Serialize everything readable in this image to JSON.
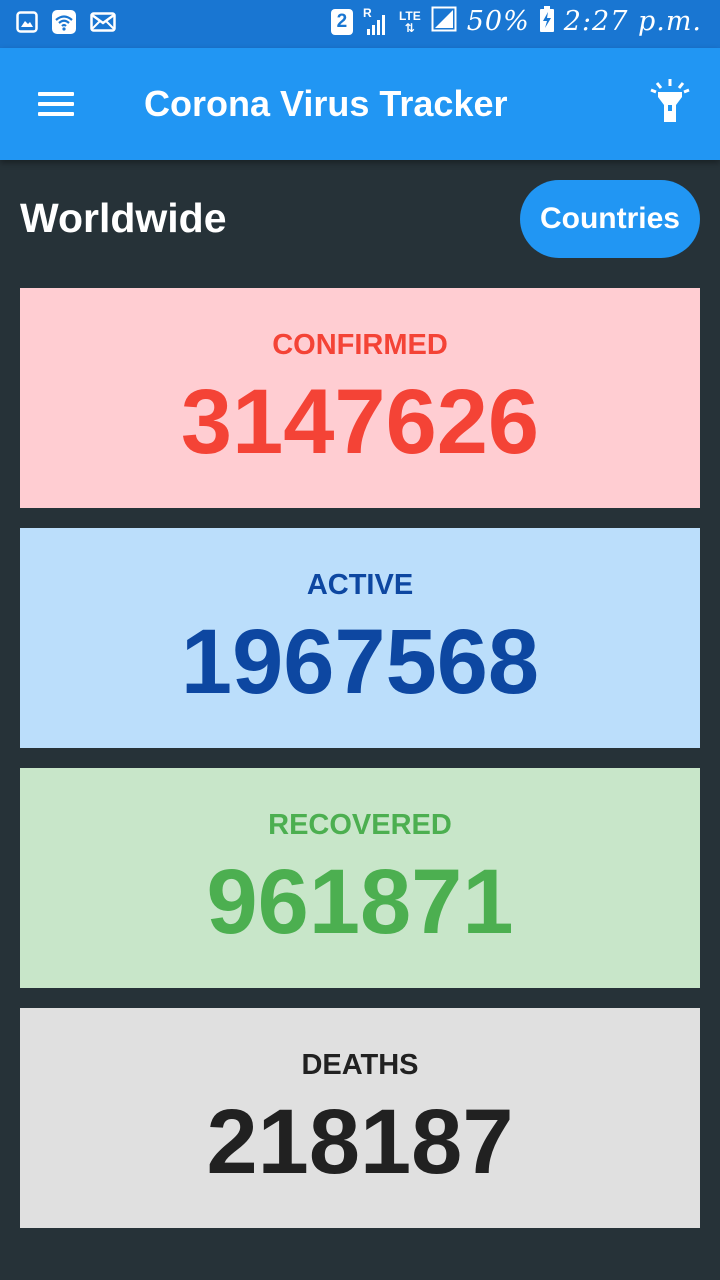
{
  "status_bar": {
    "sim": "2",
    "roaming": "R",
    "network": "LTE",
    "battery": "50%",
    "time": "2:27 p.m.",
    "icons": [
      "image-icon",
      "wifi-icon",
      "mail-icon",
      "sim-icon",
      "signal-icon",
      "battery-charging-icon"
    ]
  },
  "app_bar": {
    "title": "Corona Virus Tracker",
    "icons": [
      "menu-icon",
      "flashlight-icon"
    ]
  },
  "header": {
    "title": "Worldwide",
    "countries_button": "Countries"
  },
  "stats": {
    "confirmed": {
      "label": "CONFIRMED",
      "value": "3147626"
    },
    "active": {
      "label": "ACTIVE",
      "value": "1967568"
    },
    "recovered": {
      "label": "RECOVERED",
      "value": "961871"
    },
    "deaths": {
      "label": "DEATHS",
      "value": "218187"
    }
  },
  "colors": {
    "status_bar": "#1976D2",
    "app_bar": "#2196F3",
    "background": "#263238",
    "confirmed_bg": "#FFCDD2",
    "confirmed_fg": "#F44336",
    "active_bg": "#BBDEFB",
    "active_fg": "#0D47A1",
    "recovered_bg": "#C8E6C9",
    "recovered_fg": "#4CAF50",
    "deaths_bg": "#E0E0E0",
    "deaths_fg": "#212121"
  }
}
